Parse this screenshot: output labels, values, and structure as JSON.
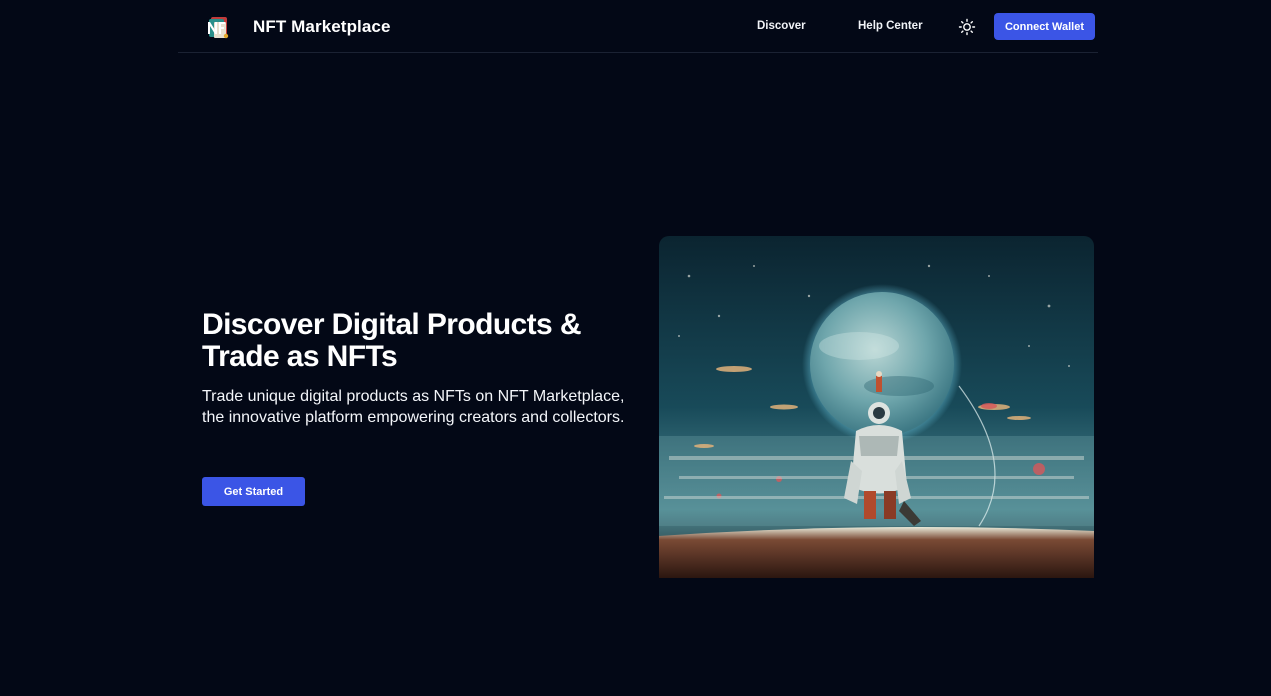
{
  "header": {
    "logo_icon": "nft-logo-icon",
    "brand": "NFT Marketplace",
    "nav": [
      {
        "label": "Discover"
      },
      {
        "label": "Help Center"
      }
    ],
    "theme_icon": "sun-icon",
    "connect_label": "Connect Wallet"
  },
  "hero": {
    "title": "Discover Digital Products & Trade as NFTs",
    "subtitle": "Trade unique digital products as NFTs on NFT Marketplace, the innovative platform empowering creators and collectors.",
    "cta_label": "Get Started",
    "artwork_icon": "astronaut-planet-artwork"
  },
  "colors": {
    "background": "#030816",
    "accent": "#3b55e6",
    "text": "#ffffff"
  }
}
